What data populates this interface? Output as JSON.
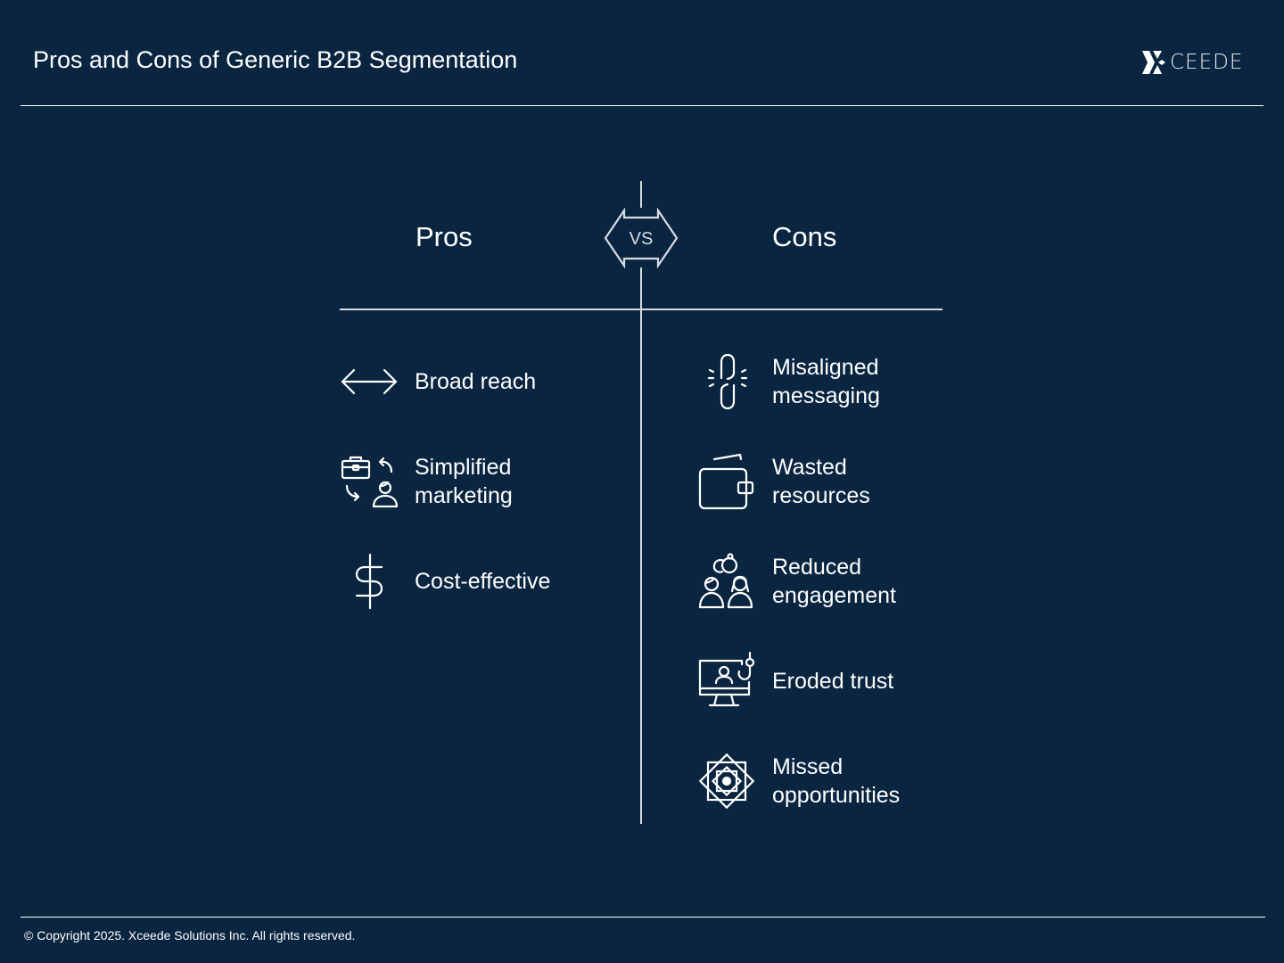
{
  "header": {
    "title": "Pros and Cons of Generic B2B Segmentation",
    "logo_text": "CEEDE",
    "logo_mark": "X"
  },
  "comparison": {
    "vs_label": "VS",
    "pros": {
      "heading": "Pros",
      "items": [
        {
          "icon": "double-arrow-icon",
          "lines": [
            "Broad reach"
          ]
        },
        {
          "icon": "briefcase-exchange-person-icon",
          "lines": [
            "Simplified",
            "marketing"
          ]
        },
        {
          "icon": "dollar-sign-icon",
          "lines": [
            "Cost-effective"
          ]
        }
      ]
    },
    "cons": {
      "heading": "Cons",
      "items": [
        {
          "icon": "broken-chain-link-icon",
          "lines": [
            "Misaligned",
            "messaging"
          ]
        },
        {
          "icon": "wallet-icon",
          "lines": [
            "Wasted",
            "resources"
          ]
        },
        {
          "icon": "people-rings-icon",
          "lines": [
            "Reduced",
            "engagement"
          ]
        },
        {
          "icon": "monitor-fishing-hook-icon",
          "lines": [
            "Eroded trust"
          ]
        },
        {
          "icon": "geometric-star-icon",
          "lines": [
            "Missed",
            "opportunities"
          ]
        }
      ]
    }
  },
  "footer": {
    "copyright": "© Copyright 2025. Xceede Solutions Inc. All rights reserved."
  },
  "colors": {
    "background": "#0a2540",
    "foreground": "#ffffff",
    "divider": "#d7dce2"
  }
}
